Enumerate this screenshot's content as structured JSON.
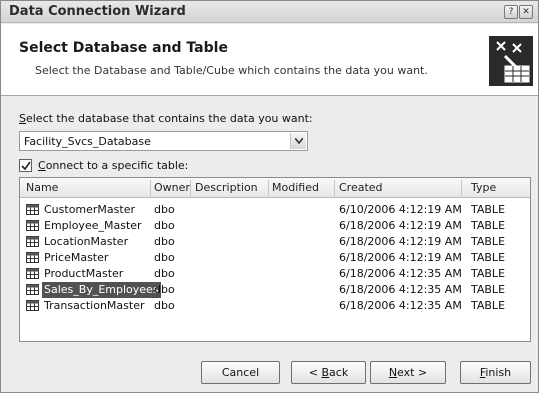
{
  "window": {
    "title": "Data Connection Wizard",
    "help_glyph": "?",
    "close_glyph": "✕"
  },
  "header": {
    "title": "Select Database and Table",
    "subtitle": "Select the Database and Table/Cube which contains the data you want.",
    "icon": "database-table-wizard-icon"
  },
  "database": {
    "label_accel": "S",
    "label_rest": "elect the database that contains the data you want:",
    "selected": "Facility_Svcs_Database"
  },
  "connect_checkbox": {
    "checked": true,
    "label_accel": "C",
    "label_rest": "onnect to a specific table:"
  },
  "table": {
    "columns": [
      "Name",
      "Owner",
      "Description",
      "Modified",
      "Created",
      "Type"
    ],
    "rows": [
      {
        "name": "CustomerMaster",
        "owner": "dbo",
        "description": "",
        "modified": "",
        "created": "6/10/2006 4:12:19 AM",
        "type": "TABLE",
        "selected": false
      },
      {
        "name": "Employee_Master",
        "owner": "dbo",
        "description": "",
        "modified": "",
        "created": "6/18/2006 4:12:19 AM",
        "type": "TABLE",
        "selected": false
      },
      {
        "name": "LocationMaster",
        "owner": "dbo",
        "description": "",
        "modified": "",
        "created": "6/18/2006 4:12:19 AM",
        "type": "TABLE",
        "selected": false
      },
      {
        "name": "PriceMaster",
        "owner": "dbo",
        "description": "",
        "modified": "",
        "created": "6/18/2006 4:12:19 AM",
        "type": "TABLE",
        "selected": false
      },
      {
        "name": "ProductMaster",
        "owner": "dbo",
        "description": "",
        "modified": "",
        "created": "6/18/2006 4:12:35 AM",
        "type": "TABLE",
        "selected": false
      },
      {
        "name": "Sales_By_Employees",
        "owner": "dbo",
        "description": "",
        "modified": "",
        "created": "6/18/2006 4:12:35 AM",
        "type": "TABLE",
        "selected": true
      },
      {
        "name": "TransactionMaster",
        "owner": "dbo",
        "description": "",
        "modified": "",
        "created": "6/18/2006 4:12:35 AM",
        "type": "TABLE",
        "selected": false
      }
    ]
  },
  "buttons": {
    "cancel": "Cancel",
    "back_pre": "< ",
    "back_accel": "B",
    "back_rest": "ack",
    "next_accel": "N",
    "next_rest": "ext >",
    "finish_accel": "F",
    "finish_rest": "inish"
  },
  "colors": {
    "selection": "#525252",
    "window_bg": "#ececec",
    "header_bg": "#ffffff"
  }
}
